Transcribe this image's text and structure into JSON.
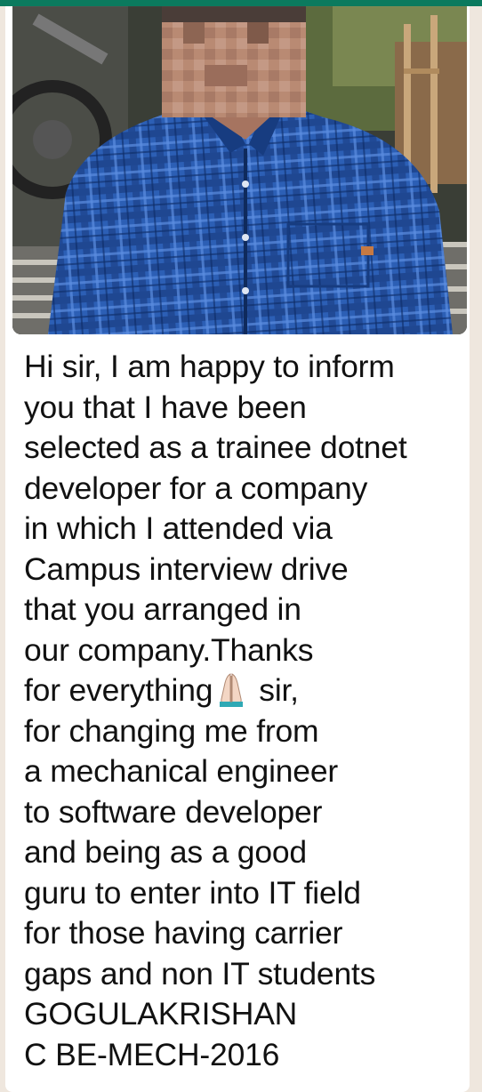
{
  "message": {
    "lines": [
      "Hi sir, I am happy to inform",
      "you that I have been",
      "selected as a trainee dotnet",
      "developer for a company",
      "in which I attended via",
      "Campus interview drive",
      "that you arranged in",
      "our company.Thanks",
      {
        "before": "for everything",
        "emoji": "folded-hands-icon",
        "after": "sir,"
      },
      "for changing me from",
      "a mechanical engineer",
      "to software developer",
      "and being as a good",
      "guru to enter into IT field",
      "for those having carrier",
      "gaps and non IT students",
      "GOGULAKRISHAN",
      "C BE-MECH-2016"
    ]
  },
  "colors": {
    "header": "#0b7a5e",
    "bubble": "#ffffff",
    "chat_background": "#efe7de",
    "text": "#111111"
  }
}
